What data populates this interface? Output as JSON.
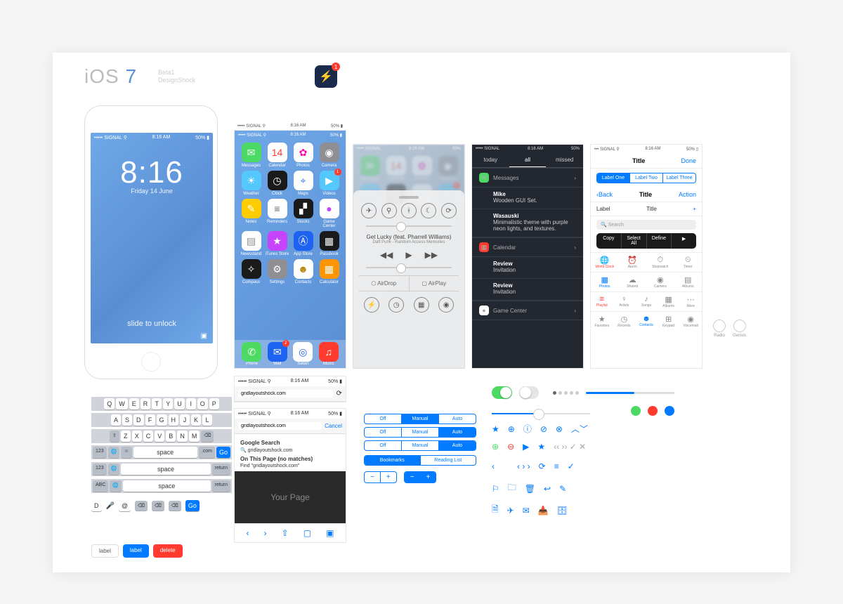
{
  "header": {
    "brand_pre": "iOS ",
    "brand_num": "7",
    "sub1": "Beta1",
    "sub2": "DesignShock",
    "bolt_badge": "1"
  },
  "statusbar": {
    "carrier": "SIGNAL",
    "time": "8:16 AM",
    "pct": "50%"
  },
  "lock": {
    "time": "8:16",
    "date": "Friday 14 June",
    "slide": "slide to unlock"
  },
  "apps": {
    "r1": [
      {
        "l": "Messages",
        "c": "#4cd964",
        "i": "✉"
      },
      {
        "l": "Calendar",
        "c": "#ffffff",
        "i": "14",
        "fg": "#ff3b30"
      },
      {
        "l": "Photos",
        "c": "#ffffff",
        "i": "✿",
        "fg": "#f0a"
      },
      {
        "l": "Camera",
        "c": "#8e8e93",
        "i": "◉"
      }
    ],
    "r2": [
      {
        "l": "Weather",
        "c": "#54c7fc",
        "i": "☀"
      },
      {
        "l": "Clock",
        "c": "#1a1a1a",
        "i": "◷"
      },
      {
        "l": "Maps",
        "c": "#ffffff",
        "i": "⌖",
        "fg": "#3478f6"
      },
      {
        "l": "Videos",
        "c": "#54c7fc",
        "i": "▶",
        "bdg": "1"
      }
    ],
    "r3": [
      {
        "l": "Notes",
        "c": "#ffcc00",
        "i": "✎"
      },
      {
        "l": "Reminders",
        "c": "#ffffff",
        "i": "≡",
        "fg": "#666"
      },
      {
        "l": "Stocks",
        "c": "#1a1a1a",
        "i": "▞"
      },
      {
        "l": "Game Center",
        "c": "#ffffff",
        "i": "●",
        "fg": "#c644fc"
      }
    ],
    "r4": [
      {
        "l": "Newsstand",
        "c": "#ffffff",
        "i": "▤",
        "fg": "#8e8e93"
      },
      {
        "l": "iTunes Store",
        "c": "#c644fc",
        "i": "★"
      },
      {
        "l": "App Store",
        "c": "#1d62f0",
        "i": "Ⓐ"
      },
      {
        "l": "Passbook",
        "c": "#1a1a1a",
        "i": "▦"
      }
    ],
    "r5": [
      {
        "l": "Compass",
        "c": "#1a1a1a",
        "i": "✧"
      },
      {
        "l": "Settings",
        "c": "#8e8e93",
        "i": "⚙"
      },
      {
        "l": "Contacts",
        "c": "#ffffff",
        "i": "☻",
        "fg": "#b8860b"
      },
      {
        "l": "Calculator",
        "c": "#ff9500",
        "i": "▦"
      }
    ],
    "dock": [
      {
        "l": "Phone",
        "c": "#4cd964",
        "i": "✆"
      },
      {
        "l": "Mail",
        "c": "#1d62f0",
        "i": "✉",
        "bdg": "2"
      },
      {
        "l": "Safari",
        "c": "#ffffff",
        "i": "◎",
        "fg": "#1d62f0"
      },
      {
        "l": "Music",
        "c": "#ff3b30",
        "i": "♫"
      }
    ]
  },
  "cc": {
    "song": "Get Lucky (feat. Pharrell Williams)",
    "artist": "Daft Punk - Random Access Memories",
    "airdrop": "AirDrop",
    "airplay": "AirPlay"
  },
  "nc": {
    "tabs": [
      "today",
      "all",
      "missed"
    ],
    "sections": [
      {
        "icon": "✉",
        "ic": "#4cd964",
        "title": "Messages",
        "items": [
          {
            "t": "Mike",
            "d": "Wooden GUI Set."
          },
          {
            "t": "Wasauski",
            "d": "Minimalistic theme with purple neon lights, and textures."
          }
        ]
      },
      {
        "icon": "▦",
        "ic": "#ff3b30",
        "title": "Calendar",
        "items": [
          {
            "t": "Review",
            "d": "Invitation"
          },
          {
            "t": "Review",
            "d": "Invitation"
          }
        ]
      },
      {
        "icon": "●",
        "ic": "#ffffff",
        "title": "Game Center",
        "items": []
      }
    ]
  },
  "ui": {
    "title": "Title",
    "done": "Done",
    "back": "Back",
    "action": "Action",
    "label": "Label",
    "plus": "+",
    "segs": [
      "Label One",
      "Label Two",
      "Label Three"
    ],
    "search": "Search",
    "pop": [
      "Copy",
      "Select All",
      "Define",
      "▶"
    ],
    "tb1": [
      {
        "l": "World Clock",
        "i": "🌐"
      },
      {
        "l": "Alarm",
        "i": "⏰"
      },
      {
        "l": "Stopwatch",
        "i": "⏱"
      },
      {
        "l": "Timer",
        "i": "⏲"
      }
    ],
    "tb2": [
      {
        "l": "Photos",
        "i": "▦"
      },
      {
        "l": "Shared",
        "i": "☁"
      },
      {
        "l": "Camera",
        "i": "◉"
      },
      {
        "l": "Albums",
        "i": "▤"
      }
    ],
    "tb3": [
      {
        "l": "Playlist",
        "i": "≡"
      },
      {
        "l": "Artists",
        "i": "♀"
      },
      {
        "l": "Songs",
        "i": "♪"
      },
      {
        "l": "Albums",
        "i": "▦"
      },
      {
        "l": "More",
        "i": "⋯"
      }
    ],
    "tb4": [
      {
        "l": "Favorites",
        "i": "★"
      },
      {
        "l": "Recents",
        "i": "◷"
      },
      {
        "l": "Contacts",
        "i": "☻"
      },
      {
        "l": "Keypad",
        "i": "⊞"
      },
      {
        "l": "Voicemail",
        "i": "◉"
      }
    ],
    "extra": [
      {
        "l": "Radio"
      },
      {
        "l": "Genius"
      }
    ]
  },
  "kbd": {
    "r1": [
      "Q",
      "W",
      "E",
      "R",
      "T",
      "Y",
      "U",
      "I",
      "O",
      "P"
    ],
    "r2": [
      "A",
      "S",
      "D",
      "F",
      "G",
      "H",
      "J",
      "K",
      "L"
    ],
    "r3": [
      "⇧",
      "Z",
      "X",
      "C",
      "V",
      "B",
      "N",
      "M",
      "⌫"
    ],
    "r4": [
      "123",
      "🌐",
      "☺",
      "space",
      ".com",
      "Go"
    ],
    "r5": [
      "123",
      "🌐",
      "space",
      "return"
    ],
    "r6": [
      "ABC",
      "🌐",
      "space",
      "return"
    ]
  },
  "buttons": {
    "label": "label",
    "delete": "delete",
    "go": "Go",
    "e1": "D",
    "e2": "@"
  },
  "safari": {
    "url": "gridlayoutshock.com",
    "cancel": "Cancel",
    "gs": "Google Search",
    "query": "gridlayoutshock.com",
    "otp": "On This Page (no matches)",
    "find": "Find \"gridlayoutshock.com\"",
    "page": "Your Page"
  },
  "segs": {
    "rows": [
      {
        "opts": [
          "Off",
          "Manual",
          "Auto"
        ],
        "on": 1
      },
      {
        "opts": [
          "Off",
          "Manual",
          "Auto"
        ],
        "on": 2
      },
      {
        "opts": [
          "Off",
          "Manual",
          "Auto"
        ],
        "on": 2
      }
    ],
    "btm": [
      "Bookmarks",
      "Reading List"
    ]
  }
}
